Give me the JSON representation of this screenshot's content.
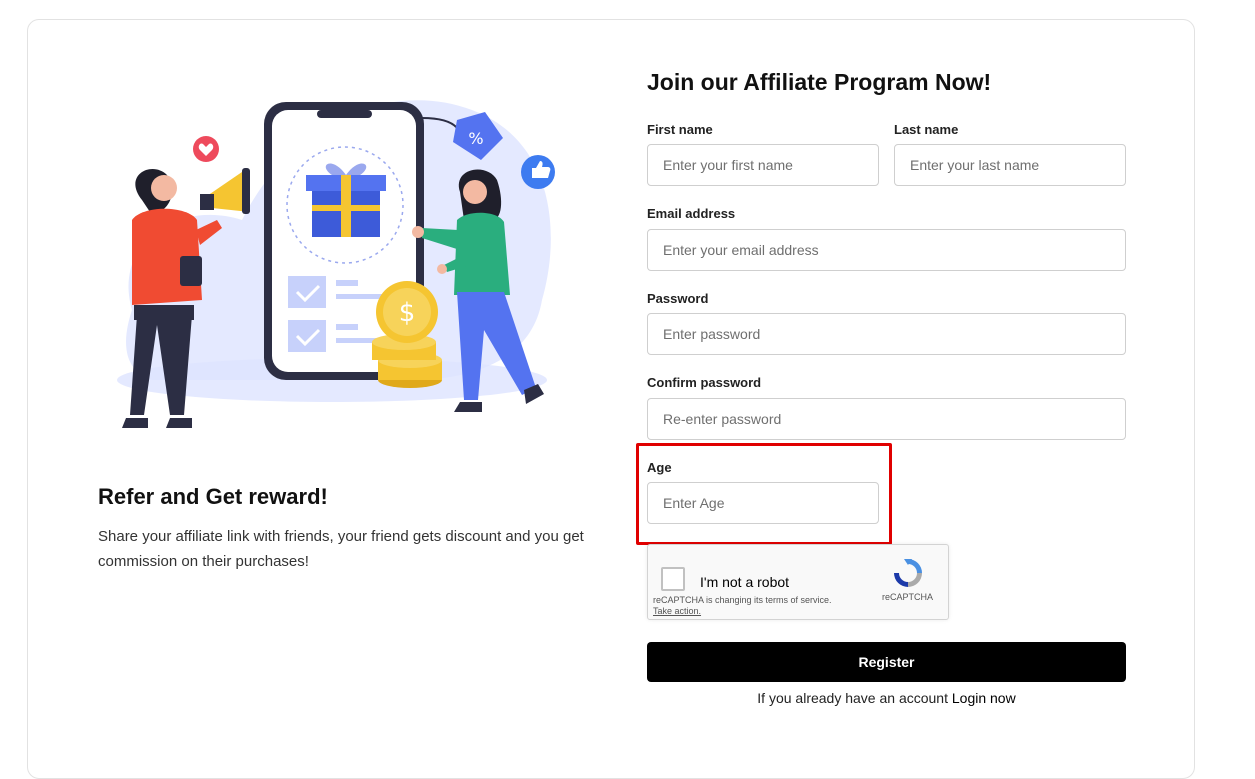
{
  "promo": {
    "title": "Refer and Get reward!",
    "description": "Share your affiliate link with friends, your friend gets discount and you get commission on their purchases!"
  },
  "form": {
    "title": "Join our Affiliate Program Now!",
    "first_name": {
      "label": "First name",
      "placeholder": "Enter your first name"
    },
    "last_name": {
      "label": "Last name",
      "placeholder": "Enter your last name"
    },
    "email": {
      "label": "Email address",
      "placeholder": "Enter your email address"
    },
    "password": {
      "label": "Password",
      "placeholder": "Enter password"
    },
    "confirm_password": {
      "label": "Confirm password",
      "placeholder": "Re-enter password"
    },
    "age": {
      "label": "Age",
      "placeholder": "Enter Age"
    },
    "register_label": "Register",
    "login_prompt": "If you already have an account",
    "login_link": "Login now"
  },
  "recaptcha": {
    "label": "I'm not a robot",
    "notice": "reCAPTCHA is changing its terms of service.",
    "notice_link": "Take action.",
    "brand": "reCAPTCHA"
  },
  "colors": {
    "highlight": "#e00000",
    "register_bg": "#000000",
    "illustration_accent": "#3d5bd9"
  },
  "icons": [
    "heart-icon",
    "megaphone-icon",
    "percent-tag-icon",
    "thumbs-up-icon",
    "gift-icon",
    "dollar-coin-icon",
    "checkbox-icon",
    "recaptcha-logo-icon"
  ]
}
